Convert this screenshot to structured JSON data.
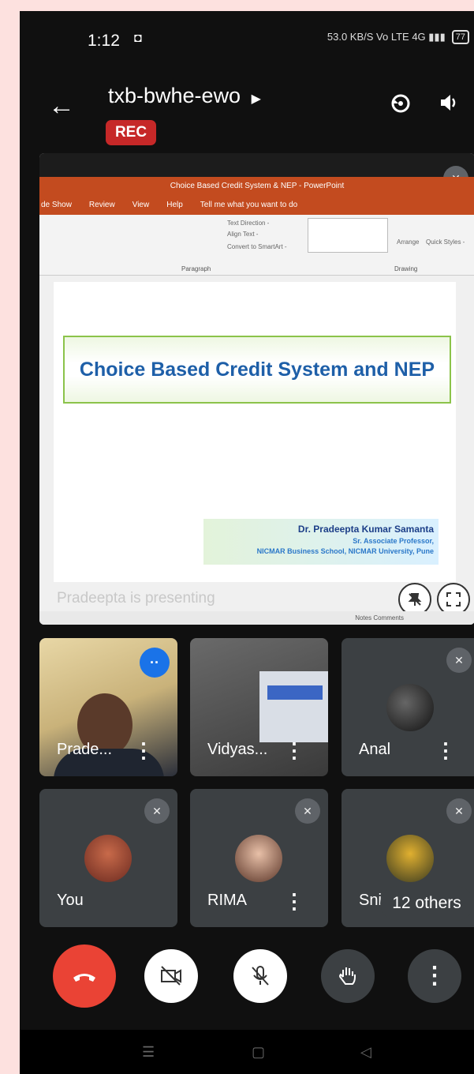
{
  "status_bar": {
    "time": "1:12",
    "right": "53.0 KB/S  Vo LTE  4G  ▮▮▮",
    "battery": "77"
  },
  "meeting": {
    "code": "txb-bwhe-ewo",
    "rec_label": "REC"
  },
  "presentation": {
    "app_title": "Choice Based Credit System & NEP  -  PowerPoint",
    "menu": [
      "de Show",
      "Review",
      "View",
      "Help",
      "Tell me what you want to do"
    ],
    "ribbon_groups": [
      "Paragraph",
      "Drawing"
    ],
    "ribbon_items": [
      "Text Direction -",
      "Align Text -",
      "Convert to SmartArt -",
      "Arrange",
      "Quick Styles -"
    ],
    "slide_title": "Choice Based Credit System and NEP",
    "author_name": "Dr. Pradeepta Kumar Samanta",
    "author_role": "Sr. Associate Professor,",
    "author_school": "NICMAR Business School, NICMAR University, Pune",
    "presenting_text": "Pradeepta is presenting",
    "status_items": "Notes    Comments"
  },
  "participants": [
    {
      "name": "Prade..."
    },
    {
      "name": "Vidyas..."
    },
    {
      "name": "Anal"
    },
    {
      "name": "You"
    },
    {
      "name": "RIMA"
    },
    {
      "name": "Sni"
    }
  ],
  "others_label": "12 others",
  "colors": {
    "end_call": "#ea4335",
    "rec": "#c62828",
    "speaking": "#1a73e8",
    "tile_bg": "#3c4043"
  }
}
